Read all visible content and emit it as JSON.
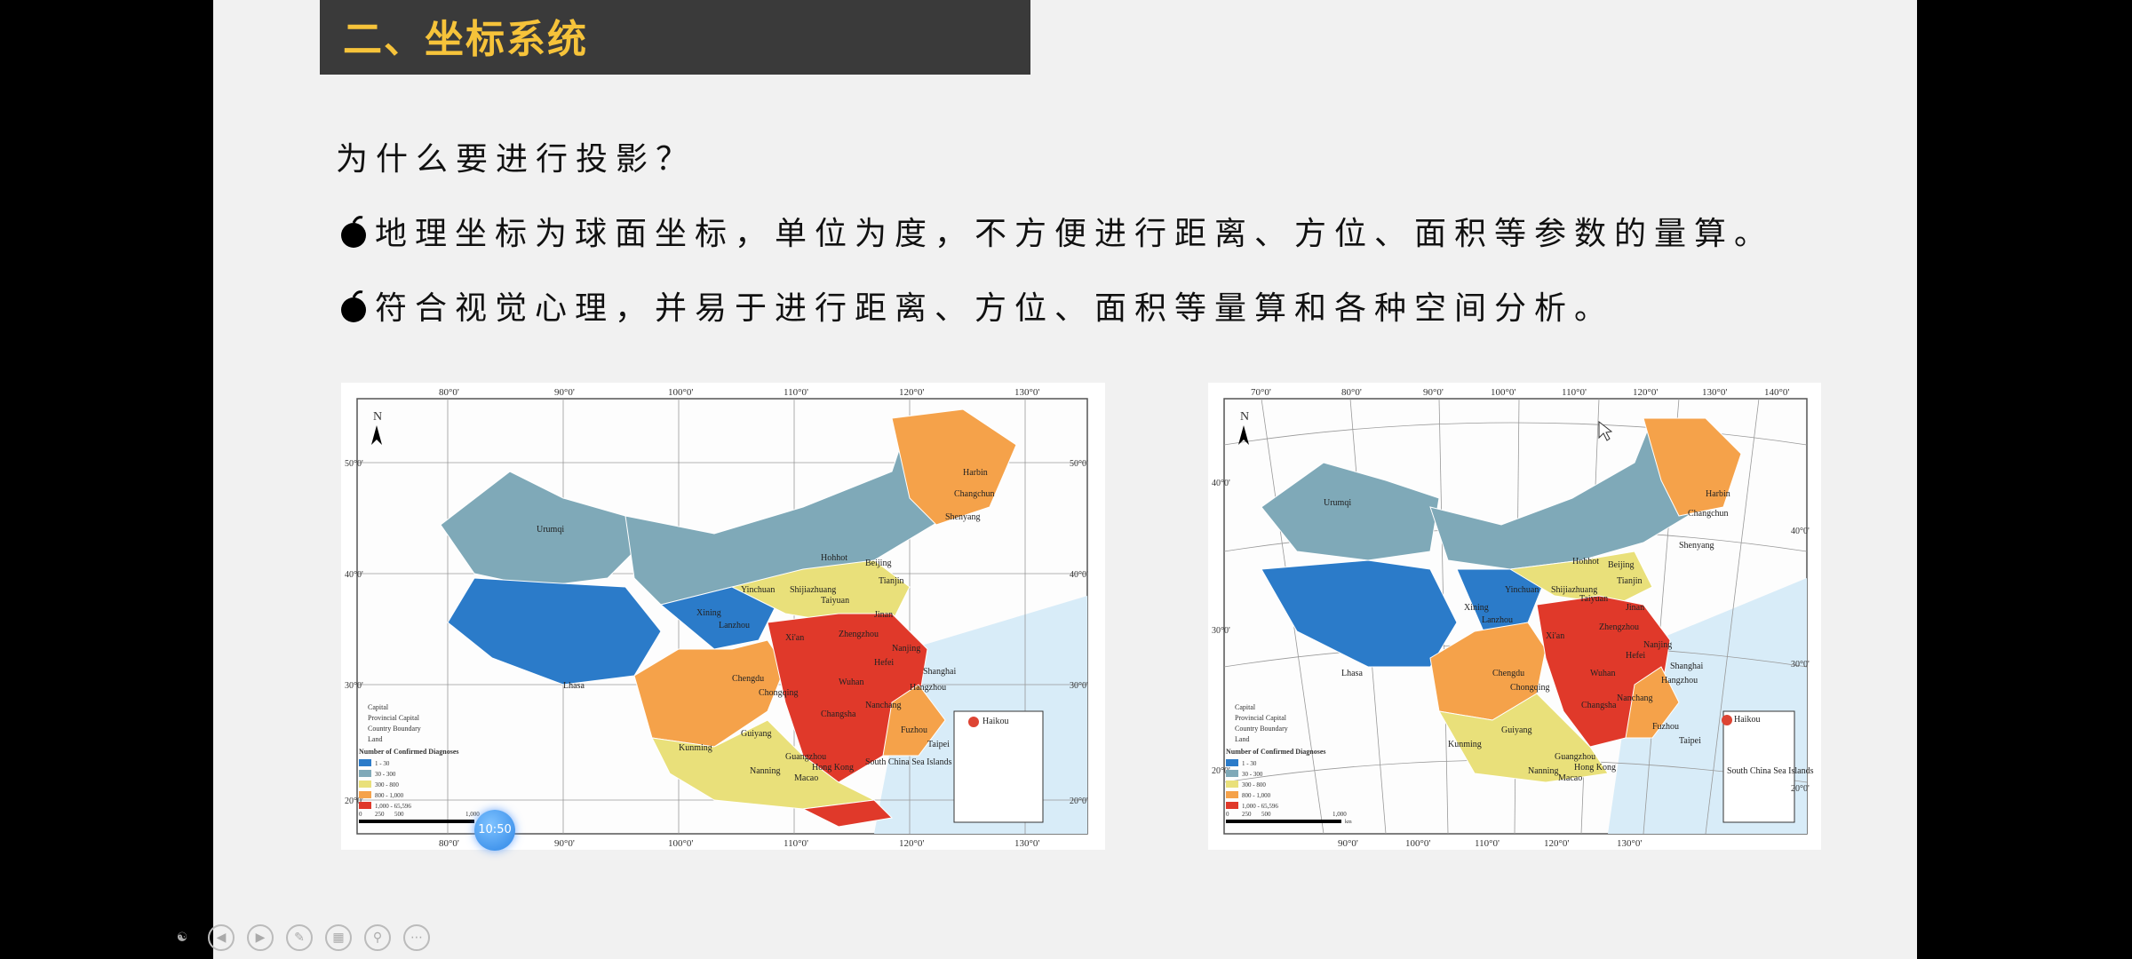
{
  "slide": {
    "title": "二、坐标系统",
    "question": "为什么要进行投影？",
    "bullets": [
      "地理坐标为球面坐标，单位为度，不方便进行距离、方位、面积等参数的量算。",
      "符合视觉心理，并易于进行距离、方位、面积等量算和各种空间分析。"
    ]
  },
  "maps": {
    "left": {
      "north": "N",
      "top_ticks": [
        "80°0'",
        "90°0'",
        "100°0'",
        "110°0'",
        "120°0'",
        "130°0'"
      ],
      "bottom_ticks": [
        "80°0'",
        "90°0'",
        "100°0'",
        "110°0'",
        "120°0'",
        "130°0'"
      ],
      "left_ticks": [
        "50°0'",
        "40°0'",
        "30°0'",
        "20°0'"
      ],
      "right_ticks": [
        "50°0'",
        "40°0'",
        "30°0'",
        "20°0'"
      ],
      "cities": [
        "Urumqi",
        "Harbin",
        "Changchun",
        "Shenyang",
        "Hohhot",
        "Beijing",
        "Tianjin",
        "Yinchuan",
        "Shijiazhuang",
        "Taiyuan",
        "Xining",
        "Lanzhou",
        "Jinan",
        "Zhengzhou",
        "Xi'an",
        "Nanjing",
        "Hefei",
        "Shanghai",
        "Hangzhou",
        "Chengdu",
        "Chongqing",
        "Wuhan",
        "Changsha",
        "Nanchang",
        "Lhasa",
        "Guiyang",
        "Kunming",
        "Fuzhou",
        "Taipei",
        "Guangzhou",
        "Nanning",
        "Hong Kong",
        "Macao",
        "Haikou",
        "South China Sea Islands"
      ],
      "legend": {
        "items": [
          "Capital",
          "Provincial Capital",
          "Country Boundary",
          "Land"
        ],
        "title": "Number of Confirmed Diagnoses",
        "classes": [
          "1 - 30",
          "30 - 300",
          "300 - 800",
          "800 - 1,000",
          "1,000 - 65,596"
        ],
        "scale": [
          "0",
          "250",
          "500",
          "1,000"
        ],
        "unit": "km"
      }
    },
    "right": {
      "north": "N",
      "top_ticks": [
        "70°0'",
        "80°0'",
        "90°0'",
        "100°0'",
        "110°0'",
        "120°0'",
        "130°0'",
        "140°0'"
      ],
      "bottom_ticks": [
        "90°0'",
        "100°0'",
        "110°0'",
        "120°0'",
        "130°0'"
      ],
      "left_ticks": [
        "40°0'",
        "30°0'",
        "20°0'"
      ],
      "right_ticks": [
        "40°0'",
        "30°0'",
        "20°0'"
      ],
      "cities": [
        "Urumqi",
        "Harbin",
        "Changchun",
        "Shenyang",
        "Hohhot",
        "Beijing",
        "Tianjin",
        "Yinchuan",
        "Shijiazhuang",
        "Taiyuan",
        "Xining",
        "Lanzhou",
        "Jinan",
        "Zhengzhou",
        "Xi'an",
        "Nanjing",
        "Hefei",
        "Shanghai",
        "Hangzhou",
        "Chengdu",
        "Chongqing",
        "Wuhan",
        "Changsha",
        "Nanchang",
        "Lhasa",
        "Guiyang",
        "Kunming",
        "Fuzhou",
        "Taipei",
        "Guangzhou",
        "Nanning",
        "Hong Kong",
        "Macao",
        "Haikou",
        "South China Sea Islands"
      ],
      "legend": {
        "items": [
          "Capital",
          "Provincial Capital",
          "Country Boundary",
          "Land"
        ],
        "title": "Number of Confirmed Diagnoses",
        "classes": [
          "1 - 30",
          "30 - 300",
          "300 - 800",
          "800 - 1,000",
          "1,000 - 65,596"
        ],
        "scale": [
          "0",
          "250",
          "500",
          "1,000"
        ],
        "unit": "km"
      }
    },
    "class_colors": [
      "#2b7bc9",
      "#7fa9b8",
      "#e9e07a",
      "#f5a24a",
      "#e0392a"
    ]
  },
  "player": {
    "clock": "10:50",
    "toolbar_icons": [
      "people-icon",
      "prev-icon",
      "next-icon",
      "pen-icon",
      "slides-icon",
      "zoom-icon",
      "more-icon"
    ]
  }
}
